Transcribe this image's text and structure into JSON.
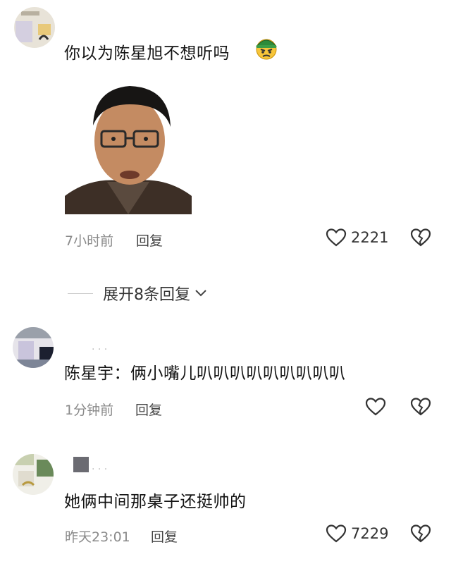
{
  "comments": [
    {
      "text": "你以为陈星旭不想听吗",
      "emoji_icon": "angry-face-with-helmet-emoji",
      "time": "7小时前",
      "reply_label": "回复",
      "likes": "2221"
    },
    {
      "text": "陈星宇：俩小嘴儿叭叭叭叭叭叭叭叭叭",
      "time": "1分钟前",
      "reply_label": "回复",
      "likes": ""
    },
    {
      "text": "她俩中间那桌子还挺帅的",
      "time": "昨天23:01",
      "reply_label": "回复",
      "likes": "7229"
    }
  ],
  "expand_replies": "展开8条回复",
  "colors": {
    "text": "#141414",
    "meta": "#8a8a8a",
    "icon": "#333333"
  },
  "icons": {
    "like": "heart-outline-icon",
    "dislike": "broken-heart-icon",
    "expand": "chevron-down-icon"
  }
}
